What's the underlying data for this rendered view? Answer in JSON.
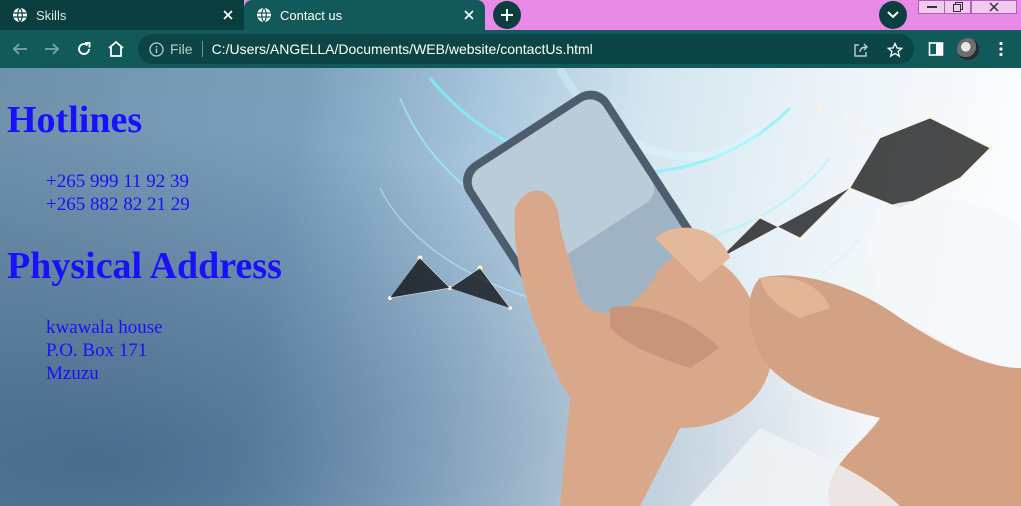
{
  "browser": {
    "tabs": [
      {
        "title": "Skills",
        "active": false
      },
      {
        "title": "Contact us",
        "active": true
      }
    ],
    "omnibox": {
      "scheme_label": "File",
      "url": "C:/Users/ANGELLA/Documents/WEB/website/contactUs.html"
    },
    "colors": {
      "tabstrip": "#e88ae6",
      "toolbar": "#125a5a",
      "inactive_tab": "#0b3f3f"
    }
  },
  "page": {
    "hotlines": {
      "heading": "Hotlines",
      "numbers": [
        "+265 999 11 92 39",
        "+265 882 82 21 29"
      ]
    },
    "address": {
      "heading": "Physical Address",
      "lines": [
        "kwawala house",
        "P.O. Box 171",
        "Mzuzu"
      ]
    },
    "text_color": "#1a10ff"
  }
}
